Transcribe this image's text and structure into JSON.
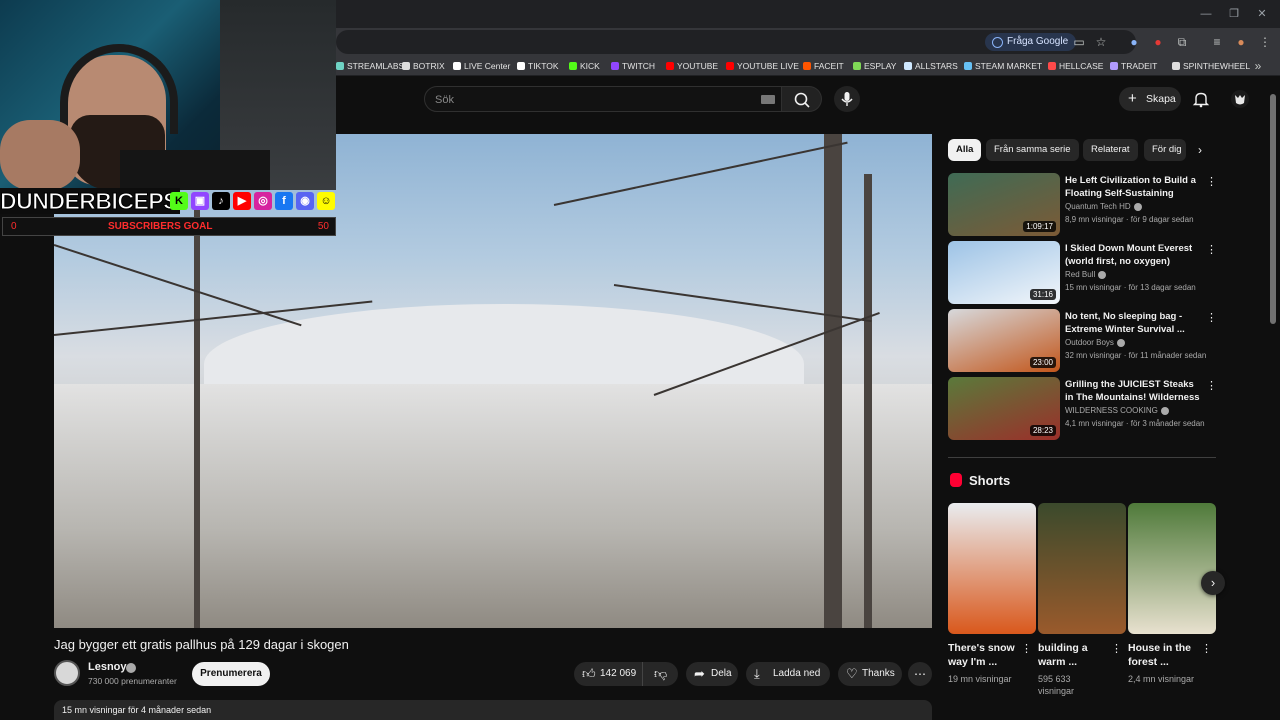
{
  "browser": {
    "ask_google": "Fråga Google",
    "bookmarks": [
      {
        "label": "STREAMLABS",
        "color": "#6fd3c4"
      },
      {
        "label": "BOTRIX",
        "color": "#dddddd"
      },
      {
        "label": "LIVE Center",
        "color": "#ffffff"
      },
      {
        "label": "TIKTOK",
        "color": "#ffffff"
      },
      {
        "label": "KICK",
        "color": "#53fc18"
      },
      {
        "label": "TWITCH",
        "color": "#9146ff"
      },
      {
        "label": "YOUTUBE",
        "color": "#ff0000"
      },
      {
        "label": "YOUTUBE LIVE",
        "color": "#ff0000"
      },
      {
        "label": "FACEIT",
        "color": "#ff5500"
      },
      {
        "label": "ESPLAY",
        "color": "#7fd856"
      },
      {
        "label": "ALLSTARS",
        "color": "#cfe8ff"
      },
      {
        "label": "STEAM MARKET",
        "color": "#66c0f4"
      },
      {
        "label": "HELLCASE",
        "color": "#ff4a4a"
      },
      {
        "label": "TRADEIT",
        "color": "#b29bff"
      },
      {
        "label": "SPINTHEWHEEL",
        "color": "#dddddd"
      }
    ]
  },
  "overlay": {
    "streamer_name": "DUNDERBICEPS",
    "goal_start": "0",
    "goal_label": "SUBSCRIBERS GOAL",
    "goal_end": "50"
  },
  "header": {
    "search_placeholder": "Sök",
    "create_label": "Skapa"
  },
  "video": {
    "title": "Jag bygger ett gratis pallhus på 129 dagar i skogen",
    "channel": "Lesnoy",
    "subscribers": "730 000 prenumeranter",
    "subscribe_label": "Prenumerera",
    "likes": "142 069",
    "share_label": "Dela",
    "download_label": "Ladda ned",
    "thanks_label": "Thanks",
    "views_date": "15 mn visningar  för 4 månader sedan"
  },
  "chips": [
    "Alla",
    "Från samma serie",
    "Relaterat",
    "För dig"
  ],
  "recommendations": [
    {
      "title": "He Left Civilization to Build a Floating Self-Sustaining Islan...",
      "channel": "Quantum Tech HD",
      "meta": "8,9 mn visningar · för 9 dagar sedan",
      "duration": "1:09:17",
      "colors": [
        "#3f6b55",
        "#7c5a36"
      ]
    },
    {
      "title": "I Skied Down Mount Everest (world first, no oxygen)",
      "channel": "Red Bull",
      "meta": "15 mn visningar · för 13 dagar sedan",
      "duration": "31:16",
      "colors": [
        "#9dc3e6",
        "#f2f6fa"
      ]
    },
    {
      "title": "No tent, No sleeping bag - Extreme Winter Survival ...",
      "channel": "Outdoor Boys",
      "meta": "32 mn visningar · för 11 månader sedan",
      "duration": "23:00",
      "colors": [
        "#d7d9dc",
        "#c2561b"
      ]
    },
    {
      "title": "Grilling the JUICIEST Steaks in The Mountains! Wilderness ...",
      "channel": "WILDERNESS COOKING",
      "meta": "4,1 mn visningar · för 3 månader sedan",
      "duration": "28:23",
      "colors": [
        "#5a7a3b",
        "#9b2f2a"
      ]
    }
  ],
  "shorts": {
    "title": "Shorts",
    "items": [
      {
        "title": "There's snow way I'm ...",
        "views": "19 mn visningar",
        "colors": [
          "#e9ecef",
          "#d9581c"
        ]
      },
      {
        "title": "building a warm ...",
        "views": "595 633 visningar",
        "colors": [
          "#3b4a2c",
          "#9a5a2c"
        ]
      },
      {
        "title": "House in the forest ...",
        "views": "2,4 mn visningar",
        "colors": [
          "#4f7a3a",
          "#e8e1cf"
        ]
      }
    ]
  }
}
